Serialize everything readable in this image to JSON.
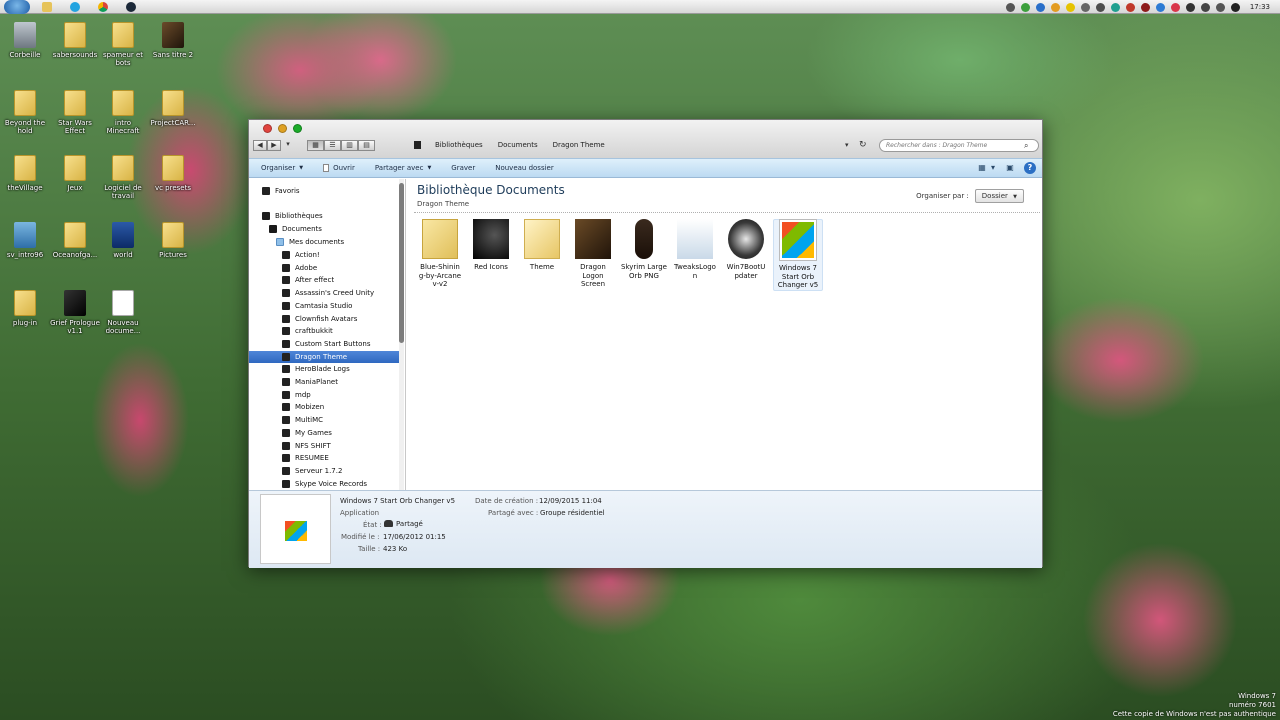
{
  "taskbar": {
    "clock": "17:33"
  },
  "desktop_icons": [
    {
      "label": "Corbeille",
      "glyph": "recycle-bin"
    },
    {
      "label": "sabersounds",
      "glyph": "folder"
    },
    {
      "label": "spameur et bots",
      "glyph": "folder"
    },
    {
      "label": "Sans titre 2",
      "glyph": "game"
    },
    {
      "label": "Beyond the hold",
      "glyph": "folder"
    },
    {
      "label": "Star Wars Effect",
      "glyph": "folder"
    },
    {
      "label": "intro Minecraft",
      "glyph": "folder"
    },
    {
      "label": "ProjectCAR...",
      "glyph": "folder"
    },
    {
      "label": "theVillage",
      "glyph": "folder"
    },
    {
      "label": "Jeux",
      "glyph": "folder"
    },
    {
      "label": "Logiciel de travail",
      "glyph": "folder"
    },
    {
      "label": "vc presets",
      "glyph": "folder"
    },
    {
      "label": "sv_intro96",
      "glyph": "app"
    },
    {
      "label": "Oceanofga...",
      "glyph": "folder"
    },
    {
      "label": "world",
      "glyph": "photoshop"
    },
    {
      "label": "Pictures",
      "glyph": "folder"
    },
    {
      "label": "plug-in",
      "glyph": "folder"
    },
    {
      "label": "Grief Prologue v1.1",
      "glyph": "dark-app"
    },
    {
      "label": "Nouveau docume...",
      "glyph": "document"
    }
  ],
  "window": {
    "breadcrumb": [
      "Bibliothèques",
      "Documents",
      "Dragon Theme"
    ],
    "search_placeholder": "Rechercher dans : Dragon Theme",
    "toolbar": {
      "organize": "Organiser",
      "open": "Ouvrir",
      "share": "Partager avec",
      "burn": "Graver",
      "new_folder": "Nouveau dossier"
    },
    "nav": {
      "favorites": "Favoris",
      "libraries": "Bibliothèques",
      "documents": "Documents",
      "my_documents": "Mes documents",
      "folders": [
        "Action!",
        "Adobe",
        "After effect",
        "Assassin's Creed Unity",
        "Camtasia Studio",
        "Clownfish Avatars",
        "craftbukkit",
        "Custom Start Buttons",
        "Dragon Theme",
        "HeroBlade Logs",
        "ManiaPlanet",
        "mdp",
        "Mobizen",
        "MultiMC",
        "My Games",
        "NFS SHIFT",
        "RESUMEE",
        "Serveur 1.7.2",
        "Skype Voice Records"
      ],
      "selected_folder": "Dragon Theme"
    },
    "content": {
      "title": "Bibliothèque Documents",
      "subtitle": "Dragon Theme",
      "arrange_label": "Organiser par :",
      "arrange_value": "Dossier",
      "files": [
        {
          "label": "Blue-Shining-by-Arcanev-v2",
          "display": "Blue-Shinin\ng-by-Arcane\nv-v2",
          "thumb": "folder"
        },
        {
          "label": "Red Icons",
          "display": "Red Icons",
          "thumb": "dark"
        },
        {
          "label": "Theme",
          "display": "Theme",
          "thumb": "folder2"
        },
        {
          "label": "Dragon Logon Screen",
          "display": "Dragon\nLogon\nScreen",
          "thumb": "screen"
        },
        {
          "label": "Skyrim Large Orb PNG",
          "display": "Skyrim Large\nOrb PNG",
          "thumb": "orbs"
        },
        {
          "label": "TweaksLogon",
          "display": "TweaksLogo\nn",
          "thumb": "tweaks"
        },
        {
          "label": "Win7BootUpdater",
          "display": "Win7BootU\npdater",
          "thumb": "win7boot"
        },
        {
          "label": "Windows 7 Start Orb Changer v5",
          "display": "Windows 7\nStart Orb\nChanger v5",
          "thumb": "orbchanger",
          "selected": true
        }
      ]
    },
    "details": {
      "name": "Windows 7 Start Orb Changer v5",
      "type": "Application",
      "state_label": "État :",
      "state_value": "Partagé",
      "modified_label": "Modifié le :",
      "modified_value": "17/06/2012 01:15",
      "size_label": "Taille :",
      "size_value": "423 Ko",
      "created_label": "Date de création :",
      "created_value": "12/09/2015 11:04",
      "shared_label": "Partagé avec :",
      "shared_value": "Groupe résidentiel"
    }
  },
  "watermark": {
    "line1": "Windows 7",
    "line2": "numéro 7601",
    "line3": "Cette copie de Windows n'est pas authentique"
  },
  "colors": {
    "selection": "#2f68c0",
    "toolbar_bg": "#bcdaf2",
    "close": "#e0443e",
    "minimize": "#dea123",
    "maximize": "#1aab29"
  }
}
